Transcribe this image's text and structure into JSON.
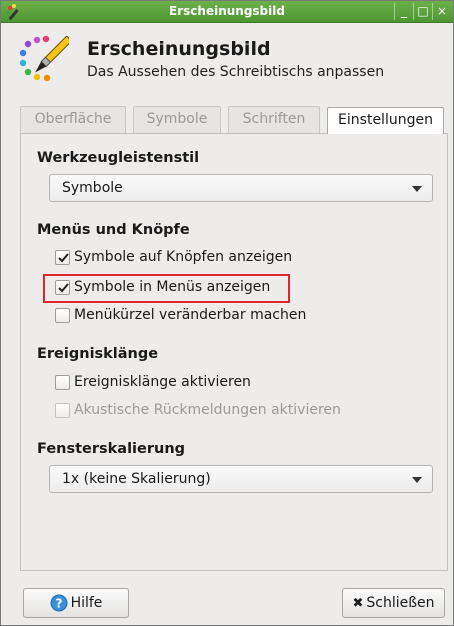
{
  "window": {
    "title": "Erscheinungsbild",
    "controls": {
      "minimize": "_",
      "maximize": "□",
      "close": "×"
    }
  },
  "header": {
    "title": "Erscheinungsbild",
    "subtitle": "Das Aussehen des Schreibtischs anpassen",
    "icon": "palette-brush-icon"
  },
  "tabs": [
    {
      "label": "Oberfläche",
      "active": false
    },
    {
      "label": "Symbole",
      "active": false
    },
    {
      "label": "Schriften",
      "active": false
    },
    {
      "label": "Einstellungen",
      "active": true
    }
  ],
  "toolbar_style": {
    "title": "Werkzeugleistenstil",
    "selected": "Symbole"
  },
  "menus_buttons": {
    "title": "Menüs und Knöpfe",
    "options": [
      {
        "label": "Symbole auf Knöpfen anzeigen",
        "checked": true,
        "enabled": true
      },
      {
        "label": "Symbole in Menüs anzeigen",
        "checked": true,
        "enabled": true
      },
      {
        "label": "Menükürzel veränderbar machen",
        "checked": false,
        "enabled": true
      }
    ]
  },
  "event_sounds": {
    "title": "Ereignisklänge",
    "options": [
      {
        "label": "Ereignisklänge aktivieren",
        "checked": false,
        "enabled": true
      },
      {
        "label": "Akustische Rückmeldungen aktivieren",
        "checked": false,
        "enabled": false
      }
    ]
  },
  "window_scaling": {
    "title": "Fensterskalierung",
    "selected": "1x (keine Skalierung)"
  },
  "buttons": {
    "help": "Hilfe",
    "close": "Schließen"
  },
  "colors": {
    "titlebar": "#5aa23c",
    "highlight": "#e0262d",
    "help_icon": "#3b8fd9"
  }
}
